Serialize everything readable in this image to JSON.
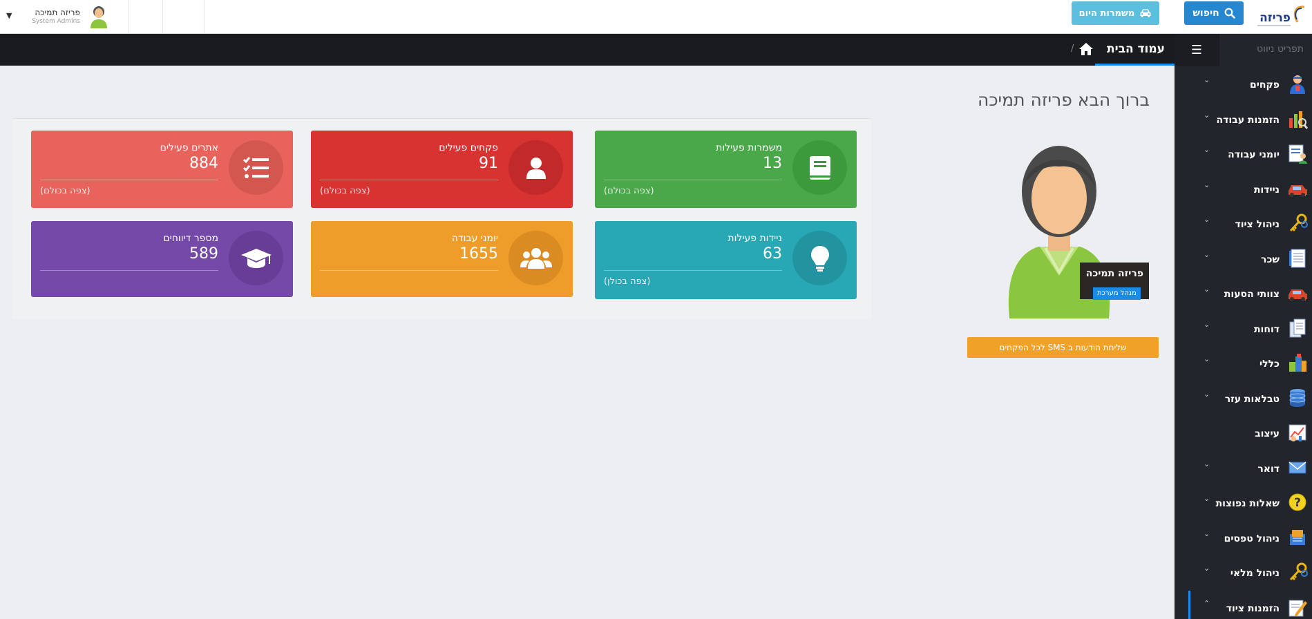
{
  "header": {
    "logo_text": "פריזה",
    "search_label": "חיפוש",
    "shifts_today_label": "משמרות היום",
    "user_name": "פריזה תמיכה",
    "user_role": "System Admins"
  },
  "sidebar": {
    "title": "תפריט ניווט",
    "items": [
      {
        "label": "פקחים",
        "icon": "inspector-icon"
      },
      {
        "label": "הזמנות עבודה",
        "icon": "chart-search-icon"
      },
      {
        "label": "יומני עבודה",
        "icon": "log-user-icon"
      },
      {
        "label": "ניידות",
        "icon": "car-icon"
      },
      {
        "label": "ניהול ציוד",
        "icon": "keys-icon"
      },
      {
        "label": "שכר",
        "icon": "document-icon"
      },
      {
        "label": "צוותי הסעות",
        "icon": "car-icon"
      },
      {
        "label": "דוחות",
        "icon": "documents-icon"
      },
      {
        "label": "כללי",
        "icon": "blocks-icon"
      },
      {
        "label": "טבלאות עזר",
        "icon": "database-icon"
      },
      {
        "label": "עיצוב",
        "icon": "design-icon"
      },
      {
        "label": "דואר",
        "icon": "mail-icon"
      },
      {
        "label": "שאלות נפוצות",
        "icon": "question-icon"
      },
      {
        "label": "ניהול טפסים",
        "icon": "forms-icon"
      },
      {
        "label": "ניהול מלאי",
        "icon": "keys-icon"
      },
      {
        "label": "הזמנות ציוד",
        "icon": "pencil-icon"
      }
    ]
  },
  "breadcrumb": {
    "title": "עמוד הבית",
    "separator": "/"
  },
  "main": {
    "welcome": "ברוך הבא פריזה תמיכה",
    "profile_name": "פריזה תמיכה",
    "profile_role": "מנהל מערכת",
    "sms_button": "שליחת הודעות ב SMS לכל הפקחים"
  },
  "cards": [
    {
      "title": "משמרות פעילות",
      "value": "13",
      "more": "(צפה בכולם)",
      "color": "#4aa84a",
      "circle": "#3c9a3c"
    },
    {
      "title": "פקחים פעילים",
      "value": "91",
      "more": "(צפה בכולם)",
      "color": "#d73331",
      "circle": "#c1292a"
    },
    {
      "title": "אתרים פעילים",
      "value": "884",
      "more": "(צפה בכולם)",
      "color": "#e8635b",
      "circle": "#d4574f"
    },
    {
      "title": "ניידות פעילות",
      "value": "63",
      "more": "(צפה בכולן)",
      "color": "#28a8b5",
      "circle": "#2194a0"
    },
    {
      "title": "יומני עבודה",
      "value": "1655",
      "more": "",
      "color": "#ee9d2a",
      "circle": "#da8c22"
    },
    {
      "title": "מספר דיווחים",
      "value": "589",
      "more": "",
      "color": "#7549a8",
      "circle": "#673d98"
    }
  ]
}
